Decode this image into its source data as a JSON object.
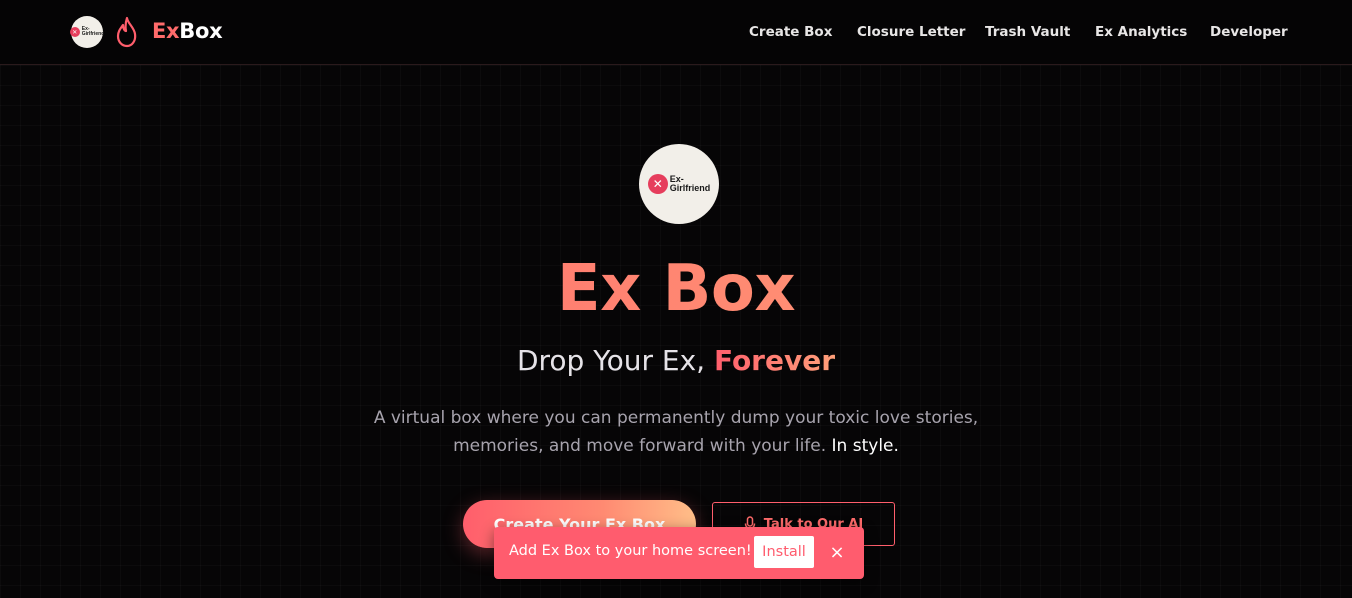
{
  "header": {
    "brand_ex": "Ex",
    "brand_box": "Box",
    "badge_line1": "Ex-",
    "badge_line2": "Girlfriend",
    "nav": [
      "Create Box",
      "Closure Letter",
      "Trash Vault",
      "Ex Analytics",
      "Developer"
    ]
  },
  "hero": {
    "logo_line1": "Ex-",
    "logo_line2": "Girlfriend",
    "title": "Ex Box",
    "subtitle_plain": "Drop Your Ex, ",
    "subtitle_accent": "Forever",
    "desc_line1": "A virtual box where you can permanently dump your toxic love stories,",
    "desc_line2": "memories, and move forward with your life.",
    "desc_strong": "In style.",
    "cta_primary": "Create Your Ex Box",
    "cta_secondary": "Talk to Our AI"
  },
  "toast": {
    "message": "Add Ex Box to your home screen!",
    "install": "Install",
    "close": "×"
  },
  "icons": {
    "flame": "flame-icon",
    "mic": "microphone-icon",
    "close": "close-icon"
  },
  "colors": {
    "accent": "#ff5e6c",
    "accent_light": "#ffb38a",
    "background": "#060506",
    "toast": "#ff5c6e"
  }
}
